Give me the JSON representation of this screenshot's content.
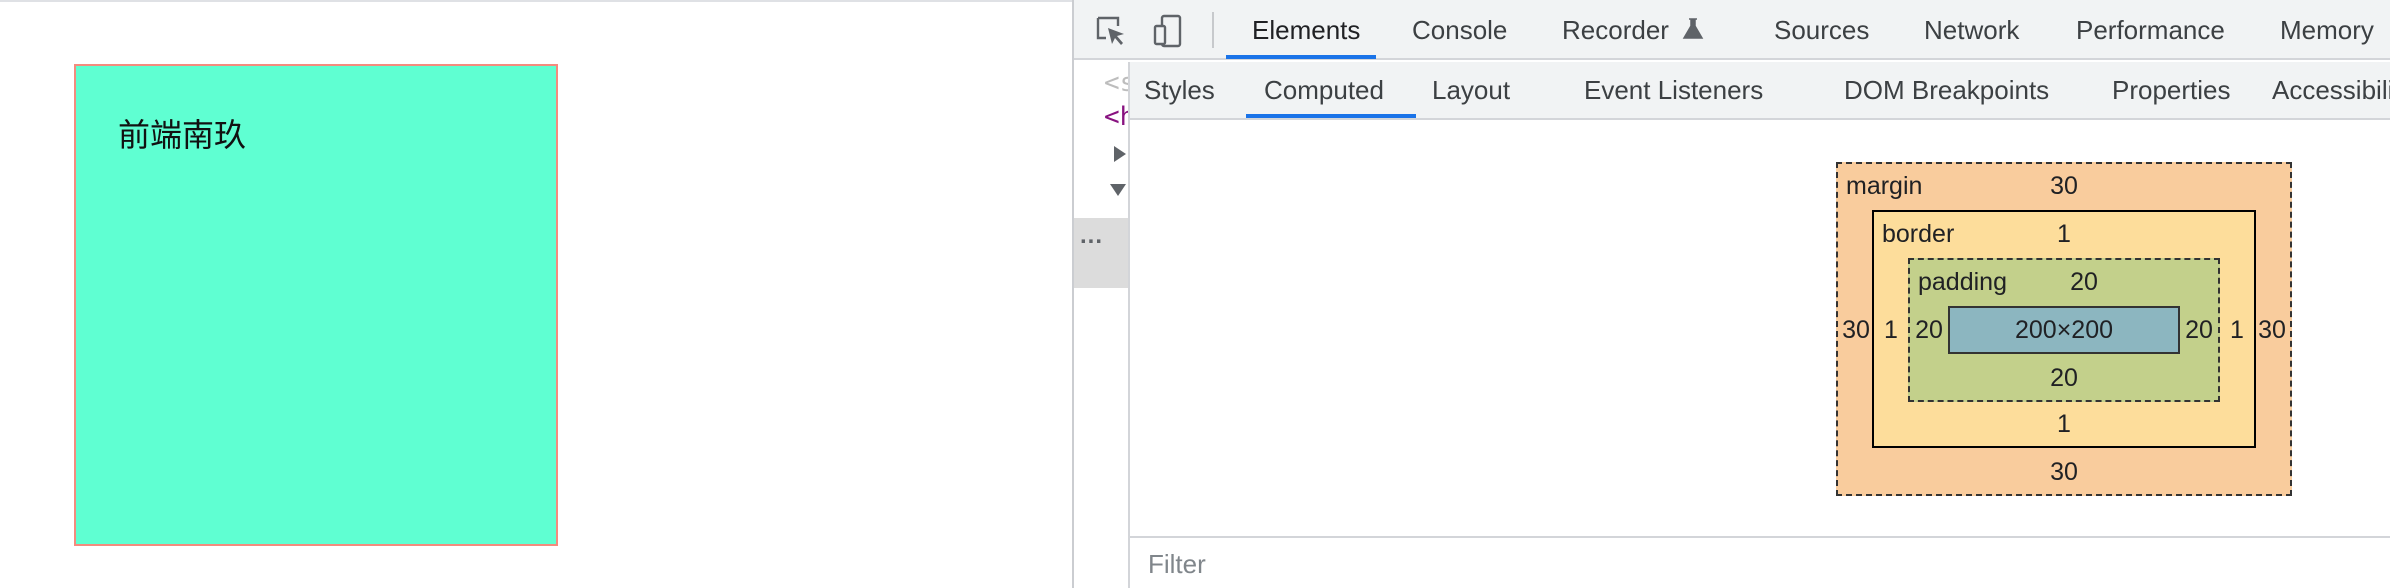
{
  "page": {
    "box_text": "前端南玖",
    "box_color": "#5fffd2",
    "box_border_color": "#f48b7e"
  },
  "devtools": {
    "toolbar_icons": [
      "inspect-element-icon",
      "device-toolbar-icon"
    ],
    "main_tabs": [
      {
        "label": "Elements",
        "active": true
      },
      {
        "label": "Console"
      },
      {
        "label": "Recorder",
        "icon": "flask-icon"
      },
      {
        "label": "Sources"
      },
      {
        "label": "Network"
      },
      {
        "label": "Performance"
      },
      {
        "label": "Memory"
      }
    ],
    "dom_tree": {
      "line1": "<s",
      "line2": "<h",
      "ellipsis": "..."
    },
    "sidebar_tabs": [
      {
        "label": "Styles"
      },
      {
        "label": "Computed",
        "active": true
      },
      {
        "label": "Layout"
      },
      {
        "label": "Event Listeners"
      },
      {
        "label": "DOM Breakpoints"
      },
      {
        "label": "Properties"
      },
      {
        "label": "Accessibility"
      }
    ],
    "box_model": {
      "margin": {
        "label": "margin",
        "top": "30",
        "right": "30",
        "bottom": "30",
        "left": "30"
      },
      "border": {
        "label": "border",
        "top": "1",
        "right": "1",
        "bottom": "1",
        "left": "1"
      },
      "padding": {
        "label": "padding",
        "top": "20",
        "right": "20",
        "bottom": "20",
        "left": "20"
      },
      "content": "200×200",
      "colors": {
        "margin": "#f9cc9d",
        "border": "#fddd9b",
        "padding": "#c3d08b",
        "content": "#8cb6c0"
      }
    },
    "filter": {
      "placeholder": "Filter"
    },
    "accent_color": "#1a73e8"
  }
}
